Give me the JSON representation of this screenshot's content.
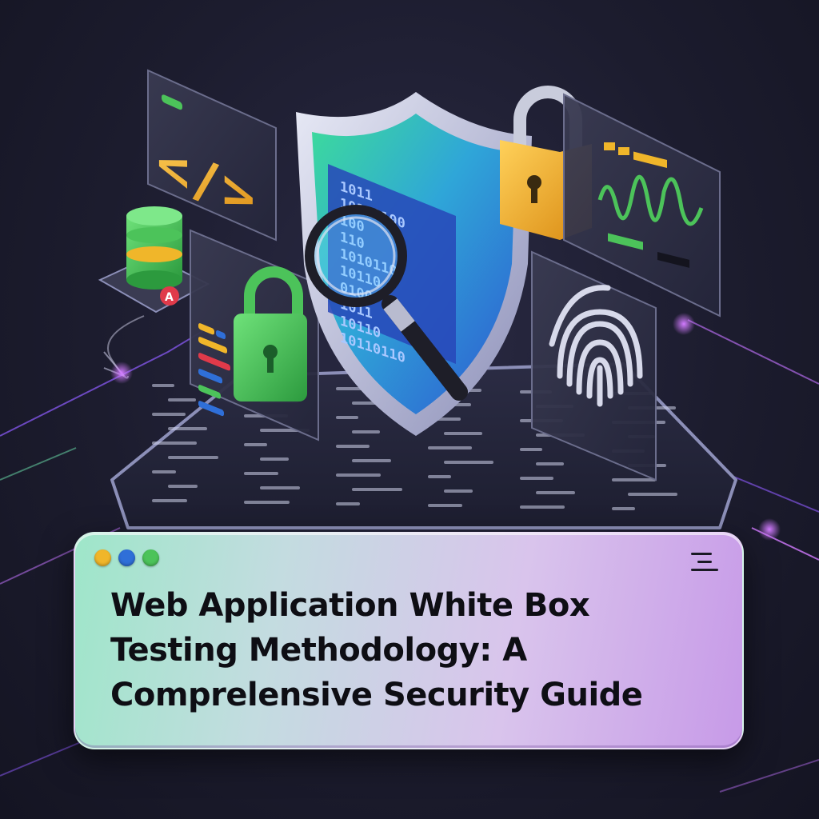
{
  "title_lines": [
    "Web Application White Box",
    "Testing Methodology: A",
    "Comprelensive Security Guide"
  ],
  "window_dots": [
    "#f0b62a",
    "#2f6fd8",
    "#4cc35a"
  ],
  "code_glyph": "</>",
  "binary_rows": [
    "1011",
    "10110100",
    "100",
    "110",
    "1010110",
    "10110",
    "0100",
    "1011",
    "10110",
    "10110110"
  ],
  "colors": {
    "accent_green": "#4cc35a",
    "accent_blue": "#2f6fd8",
    "accent_gold": "#f0b62a",
    "accent_purple": "#b06ae8"
  }
}
